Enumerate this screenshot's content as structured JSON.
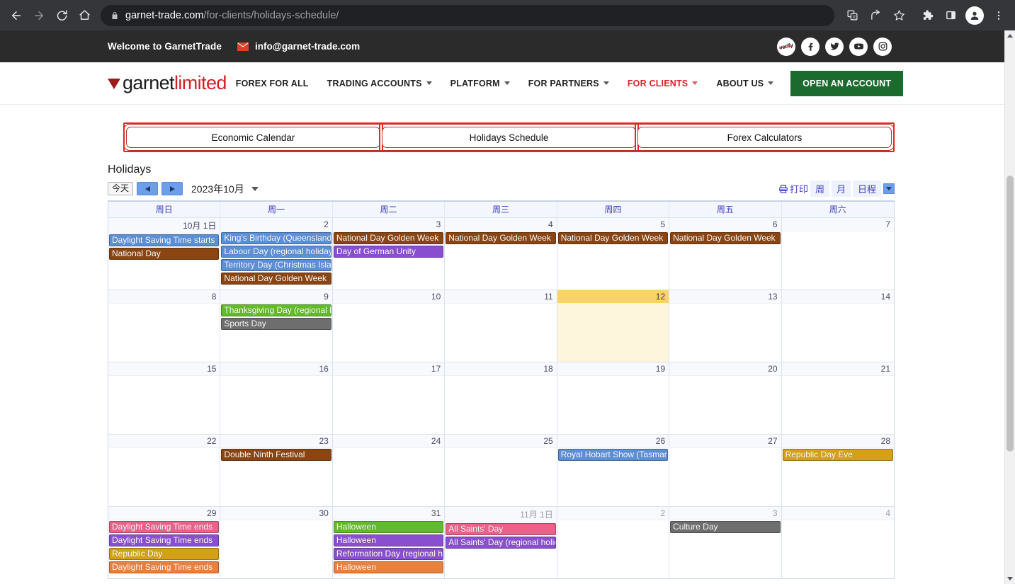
{
  "browser": {
    "url_host": "garnet-trade.com",
    "url_path": "/for-clients/holidays-schedule/",
    "icons": {
      "back": "back-arrow-icon",
      "forward": "forward-arrow-icon",
      "reload": "reload-icon",
      "home": "home-icon",
      "lock": "lock-icon",
      "translate": "translate-icon",
      "share": "share-icon",
      "bookmark": "star-icon",
      "extensions": "puzzle-icon",
      "sidepanel": "side-panel-icon",
      "profile": "profile-avatar-icon",
      "menu": "kebab-menu-icon"
    }
  },
  "topbar": {
    "welcome": "Welcome to GarnetTrade",
    "email": "info@garnet-trade.com",
    "socials": [
      {
        "name": "verify-badge",
        "glyph": "verify"
      },
      {
        "name": "facebook",
        "glyph": "f"
      },
      {
        "name": "twitter",
        "glyph": "t"
      },
      {
        "name": "youtube",
        "glyph": "y"
      },
      {
        "name": "instagram",
        "glyph": "i"
      }
    ]
  },
  "sitenav": {
    "logo_first": "garnet",
    "logo_second": "limited",
    "items": [
      {
        "label": "FOREX FOR ALL",
        "caret": false,
        "active": false
      },
      {
        "label": "TRADING ACCOUNTS",
        "caret": true,
        "active": false
      },
      {
        "label": "PLATFORM",
        "caret": true,
        "active": false
      },
      {
        "label": "FOR PARTNERS",
        "caret": true,
        "active": false
      },
      {
        "label": "FOR CLIENTS",
        "caret": true,
        "active": true
      },
      {
        "label": "ABOUT US",
        "caret": true,
        "active": false
      }
    ],
    "cta": "OPEN AN ACCOUNT",
    "accent": "#e32028",
    "cta_color": "#1b6b2f"
  },
  "tabs": [
    {
      "label": "Economic Calendar"
    },
    {
      "label": "Holidays Schedule"
    },
    {
      "label": "Forex Calculators"
    }
  ],
  "calendar": {
    "title": "Holidays",
    "today_button": "今天",
    "period": "2023年10月",
    "print_label": "打印",
    "views": [
      "周",
      "月",
      "日程"
    ],
    "dow": [
      "周日",
      "周一",
      "周二",
      "周三",
      "周四",
      "周五",
      "周六"
    ],
    "colors": {
      "blue": "#5b8fd6",
      "brown": "#8a4513",
      "purple": "#8a4fd0",
      "green": "#62bb2a",
      "gray": "#6e6e6e",
      "gold": "#d4a017",
      "pink": "#e8628a",
      "orange": "#e8803f"
    },
    "weeks": [
      [
        {
          "num": "10月 1日",
          "today": false,
          "other": false,
          "events": [
            {
              "label": "Daylight Saving Time starts",
              "color": "#5b8fd6"
            },
            {
              "label": "National Day",
              "color": "#8a4513"
            }
          ]
        },
        {
          "num": "2",
          "today": false,
          "other": false,
          "events": [
            {
              "label": "King's Birthday (Queensland)",
              "color": "#5b8fd6"
            },
            {
              "label": "Labour Day (regional holiday)",
              "color": "#5b8fd6"
            },
            {
              "label": "Territory Day (Christmas Island)",
              "color": "#5b8fd6"
            },
            {
              "label": "National Day Golden Week",
              "color": "#8a4513"
            }
          ]
        },
        {
          "num": "3",
          "today": false,
          "other": false,
          "events": [
            {
              "label": "National Day Golden Week",
              "color": "#8a4513"
            },
            {
              "label": "Day of German Unity",
              "color": "#8a4fd0"
            }
          ]
        },
        {
          "num": "4",
          "today": false,
          "other": false,
          "events": [
            {
              "label": "National Day Golden Week",
              "color": "#8a4513"
            }
          ]
        },
        {
          "num": "5",
          "today": false,
          "other": false,
          "events": [
            {
              "label": "National Day Golden Week",
              "color": "#8a4513"
            }
          ]
        },
        {
          "num": "6",
          "today": false,
          "other": false,
          "events": [
            {
              "label": "National Day Golden Week",
              "color": "#8a4513"
            }
          ]
        },
        {
          "num": "7",
          "today": false,
          "other": false,
          "events": []
        }
      ],
      [
        {
          "num": "8",
          "today": false,
          "other": false,
          "events": []
        },
        {
          "num": "9",
          "today": false,
          "other": false,
          "events": [
            {
              "label": "Thanksgiving Day (regional holiday)",
              "color": "#62bb2a"
            },
            {
              "label": "Sports Day",
              "color": "#6e6e6e"
            }
          ]
        },
        {
          "num": "10",
          "today": false,
          "other": false,
          "events": []
        },
        {
          "num": "11",
          "today": false,
          "other": false,
          "events": []
        },
        {
          "num": "12",
          "today": true,
          "other": false,
          "events": []
        },
        {
          "num": "13",
          "today": false,
          "other": false,
          "events": []
        },
        {
          "num": "14",
          "today": false,
          "other": false,
          "events": []
        }
      ],
      [
        {
          "num": "15",
          "today": false,
          "other": false,
          "events": []
        },
        {
          "num": "16",
          "today": false,
          "other": false,
          "events": []
        },
        {
          "num": "17",
          "today": false,
          "other": false,
          "events": []
        },
        {
          "num": "18",
          "today": false,
          "other": false,
          "events": []
        },
        {
          "num": "19",
          "today": false,
          "other": false,
          "events": []
        },
        {
          "num": "20",
          "today": false,
          "other": false,
          "events": []
        },
        {
          "num": "21",
          "today": false,
          "other": false,
          "events": []
        }
      ],
      [
        {
          "num": "22",
          "today": false,
          "other": false,
          "events": []
        },
        {
          "num": "23",
          "today": false,
          "other": false,
          "events": [
            {
              "label": "Double Ninth Festival",
              "color": "#8a4513"
            }
          ]
        },
        {
          "num": "24",
          "today": false,
          "other": false,
          "events": []
        },
        {
          "num": "25",
          "today": false,
          "other": false,
          "events": []
        },
        {
          "num": "26",
          "today": false,
          "other": false,
          "events": [
            {
              "label": "Royal Hobart Show (Tasmania)",
              "color": "#5b8fd6"
            }
          ]
        },
        {
          "num": "27",
          "today": false,
          "other": false,
          "events": []
        },
        {
          "num": "28",
          "today": false,
          "other": false,
          "events": [
            {
              "label": "Republic Day Eve",
              "color": "#d4a017"
            }
          ]
        }
      ],
      [
        {
          "num": "29",
          "today": false,
          "other": false,
          "events": [
            {
              "label": "Daylight Saving Time ends",
              "color": "#e8628a"
            },
            {
              "label": "Daylight Saving Time ends",
              "color": "#8a4fd0"
            },
            {
              "label": "Republic Day",
              "color": "#d4a017"
            },
            {
              "label": "Daylight Saving Time ends",
              "color": "#e8803f"
            }
          ]
        },
        {
          "num": "30",
          "today": false,
          "other": false,
          "events": []
        },
        {
          "num": "31",
          "today": false,
          "other": false,
          "events": [
            {
              "label": "Halloween",
              "color": "#62bb2a"
            },
            {
              "label": "Halloween",
              "color": "#8a4fd0"
            },
            {
              "label": "Reformation Day (regional holiday)",
              "color": "#8a4fd0"
            },
            {
              "label": "Halloween",
              "color": "#e8803f"
            }
          ]
        },
        {
          "num": "11月 1日",
          "today": false,
          "other": true,
          "events": [
            {
              "label": "All Saints' Day",
              "color": "#e8628a"
            },
            {
              "label": "All Saints' Day (regional holiday)",
              "color": "#8a4fd0"
            }
          ]
        },
        {
          "num": "2",
          "today": false,
          "other": true,
          "events": []
        },
        {
          "num": "3",
          "today": false,
          "other": true,
          "events": [
            {
              "label": "Culture Day",
              "color": "#6e6e6e"
            }
          ]
        },
        {
          "num": "4",
          "today": false,
          "other": true,
          "events": []
        }
      ]
    ]
  }
}
